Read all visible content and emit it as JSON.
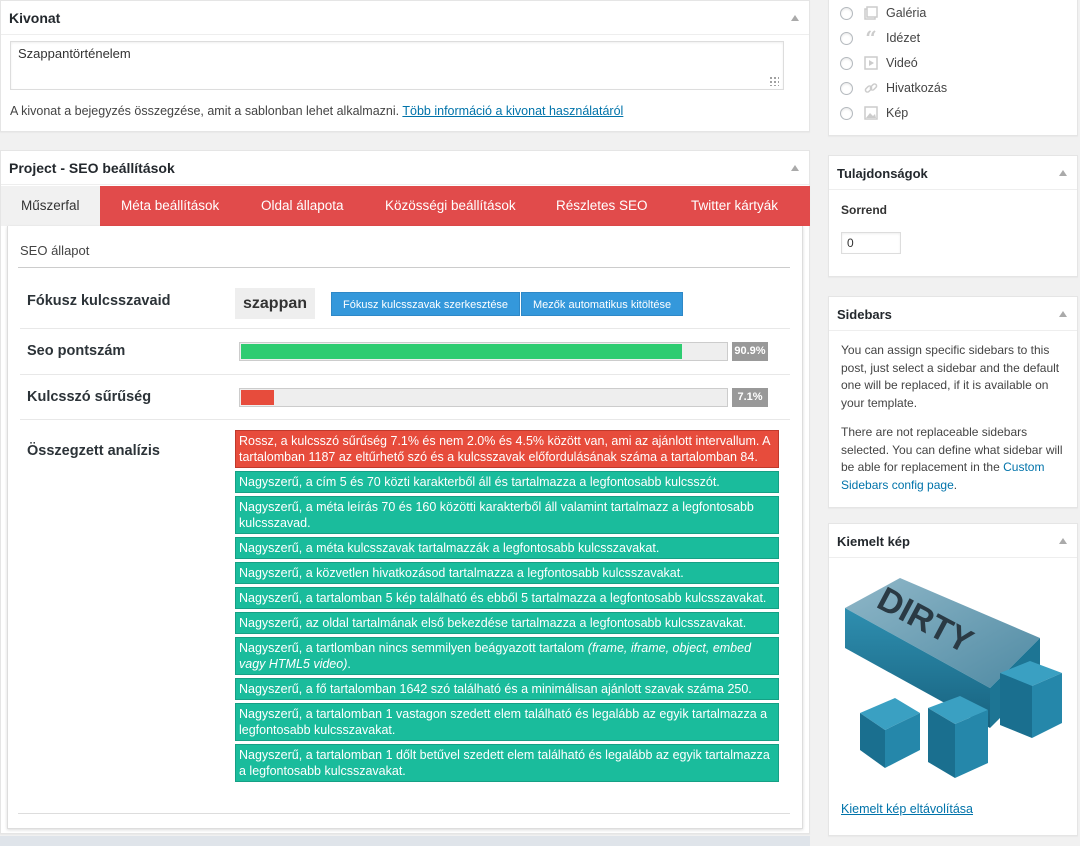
{
  "excerpt": {
    "title": "Kivonat",
    "value": "Szappantörténelem",
    "help_text": "A kivonat a bejegyzés összegzése, amit a sablonban lehet alkalmazni.",
    "help_link": "Több információ a kivonat használatáról"
  },
  "seo": {
    "title": "Project - SEO beállítások",
    "tabs": [
      {
        "label": "Műszerfal",
        "active": true
      },
      {
        "label": "Méta beállítások"
      },
      {
        "label": "Oldal állapota"
      },
      {
        "label": "Közösségi beállítások"
      },
      {
        "label": "Részletes SEO"
      },
      {
        "label": "Twitter kártyák"
      }
    ],
    "status_title": "SEO állapot",
    "focus_label": "Fókusz kulcsszavaid",
    "focus_keyword": "szappan",
    "edit_keywords_btn": "Fókusz kulcsszavak szerkesztése",
    "autofill_btn": "Mezők automatikus kitöltése",
    "score_label": "Seo pontszám",
    "score_value": 90.9,
    "score_text": "90.9%",
    "density_label": "Kulcsszó sűrűség",
    "density_value": 7.1,
    "density_text": "7.1%",
    "analysis_label": "Összegzett analízis",
    "analysis": [
      {
        "status": "bad",
        "text": "Rossz, a kulcsszó sűrűség 7.1% és nem 2.0% és 4.5% között van, ami az ajánlott intervallum. A tartalomban 1187 az eltűrhető szó és a kulcsszavak előfordulásának száma a tartalomban 84."
      },
      {
        "status": "good",
        "text": "Nagyszerű, a cím 5 és 70 közti karakterből áll és tartalmazza a legfontosabb kulcsszót."
      },
      {
        "status": "good",
        "text": "Nagyszerű, a méta leírás 70 és 160 közötti karakterből áll valamint tartalmazz a legfontosabb kulcsszavad."
      },
      {
        "status": "good",
        "text": "Nagyszerű, a méta kulcsszavak tartalmazzák a legfontosabb kulcsszavakat."
      },
      {
        "status": "good",
        "text": "Nagyszerű, a közvetlen hivatkozásod tartalmazza a legfontosabb kulcsszavakat."
      },
      {
        "status": "good",
        "text": "Nagyszerű, a tartalomban 5 kép található és ebből 5 tartalmazza a legfontosabb kulcsszavakat."
      },
      {
        "status": "good",
        "text": "Nagyszerű, az oldal tartalmának első bekezdése tartalmazza a legfontosabb kulcsszavakat."
      },
      {
        "status": "good",
        "text": "Nagyszerű, a tartlomban nincs semmilyen beágyazott tartalom ",
        "em": "(frame, iframe, object, embed vagy HTML5 video)",
        "tail": "."
      },
      {
        "status": "good",
        "text": "Nagyszerű, a fő tartalomban 1642 szó található és a minimálisan ajánlott szavak száma 250."
      },
      {
        "status": "good",
        "text": "Nagyszerű, a tartalomban 1 vastagon szedett elem található és legalább az egyik tartalmazza a legfontosabb kulcsszavakat."
      },
      {
        "status": "good",
        "text": "Nagyszerű, a tartalomban 1 dőlt betűvel szedett elem található és legalább az egyik tartalmazza a legfontosabb kulcsszavakat."
      }
    ]
  },
  "formats": [
    {
      "label": "Galéria",
      "icon": "gallery-icon"
    },
    {
      "label": "Idézet",
      "icon": "quote-icon"
    },
    {
      "label": "Videó",
      "icon": "video-icon"
    },
    {
      "label": "Hivatkozás",
      "icon": "link-icon"
    },
    {
      "label": "Kép",
      "icon": "image-icon"
    }
  ],
  "attributes": {
    "title": "Tulajdonságok",
    "order_label": "Sorrend",
    "order_value": "0"
  },
  "sidebars": {
    "title": "Sidebars",
    "text1": "You can assign specific sidebars to this post, just select a sidebar and the default one will be replaced, if it is available on your template.",
    "text2": "There are not replaceable sidebars selected. You can define what sidebar will be able for replacement in the",
    "link": "Custom Sidebars config page",
    "text2_tail": "."
  },
  "featured": {
    "title": "Kiemelt kép",
    "remove_link": "Kiemelt kép eltávolítása"
  },
  "colors": {
    "tab_bar": "#e14b4b",
    "good": "#1abc9c",
    "bad": "#e74c3c",
    "score_bar": "#2ecc71",
    "link": "#0073aa",
    "button": "#3498db"
  }
}
